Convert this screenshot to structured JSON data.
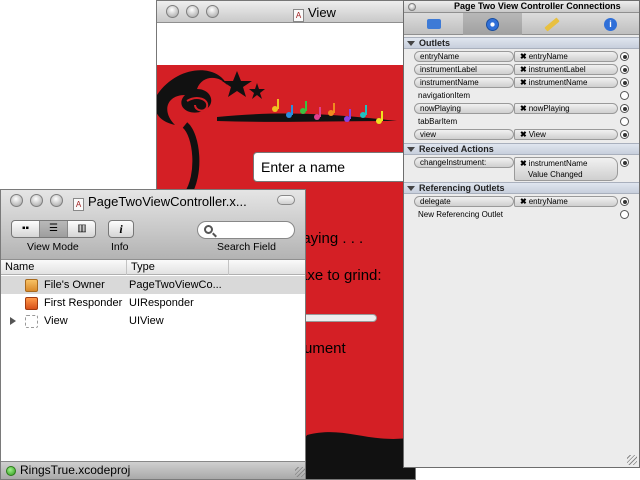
{
  "view_window": {
    "title": "View",
    "entry_placeholder": "Enter a name",
    "label_playing": "laying . . .",
    "label_axe": "axe to grind:",
    "label_instrument": "rument"
  },
  "inspector": {
    "title": "Page Two View Controller Connections",
    "tabs": [
      {
        "icon": "attributes-icon"
      },
      {
        "icon": "connections-icon"
      },
      {
        "icon": "size-icon"
      },
      {
        "icon": "identity-icon"
      }
    ],
    "sections": {
      "outlets": "Outlets",
      "received_actions": "Received Actions",
      "referencing_outlets": "Referencing Outlets"
    },
    "outlets": [
      {
        "name": "entryName",
        "target": "entryName",
        "connected": true
      },
      {
        "name": "instrumentLabel",
        "target": "instrumentLabel",
        "connected": true
      },
      {
        "name": "instrumentName",
        "target": "instrumentName",
        "connected": true
      },
      {
        "name": "navigationItem",
        "target": "",
        "connected": false
      },
      {
        "name": "nowPlaying",
        "target": "nowPlaying",
        "connected": true
      },
      {
        "name": "tabBarItem",
        "target": "",
        "connected": false
      },
      {
        "name": "view",
        "target": "View",
        "connected": true
      }
    ],
    "received_actions": [
      {
        "name": "changeInstrument:",
        "target": "instrumentName",
        "event": "Value Changed"
      }
    ],
    "referencing_outlets": [
      {
        "name": "delegate",
        "target": "entryName",
        "connected": true
      },
      {
        "name": "New Referencing Outlet",
        "target": "",
        "connected": false
      }
    ]
  },
  "document_window": {
    "title": "PageTwoViewController.x...",
    "toolbar": {
      "view_mode_label": "View Mode",
      "info_label": "Info",
      "search_label": "Search Field",
      "info_glyph": "i"
    },
    "columns": [
      "Name",
      "Type"
    ],
    "rows": [
      {
        "name": "File's Owner",
        "type": "PageTwoViewCo...",
        "icon": "cube-icon"
      },
      {
        "name": "First Responder",
        "type": "UIResponder",
        "icon": "responder-icon"
      },
      {
        "name": "View",
        "type": "UIView",
        "icon": "view-icon"
      }
    ],
    "status": "RingsTrue.xcodeproj"
  }
}
